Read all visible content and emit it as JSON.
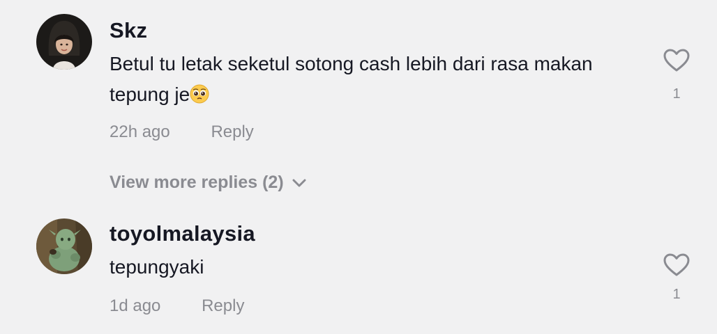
{
  "comments": [
    {
      "username": "Skz",
      "text": "Betul tu letak seketul sotong cash lebih dari rasa makan tepung je",
      "emoji": "pleading-face",
      "time": "22h ago",
      "reply_label": "Reply",
      "likes": "1"
    },
    {
      "username": "toyolmalaysia",
      "text": "tepungyaki",
      "time": "1d ago",
      "reply_label": "Reply",
      "likes": "1"
    }
  ],
  "view_more": {
    "label": "View more replies (2)"
  },
  "colors": {
    "background": "#f1f1f2",
    "text_primary": "#161823",
    "text_secondary": "#8a8b91"
  }
}
